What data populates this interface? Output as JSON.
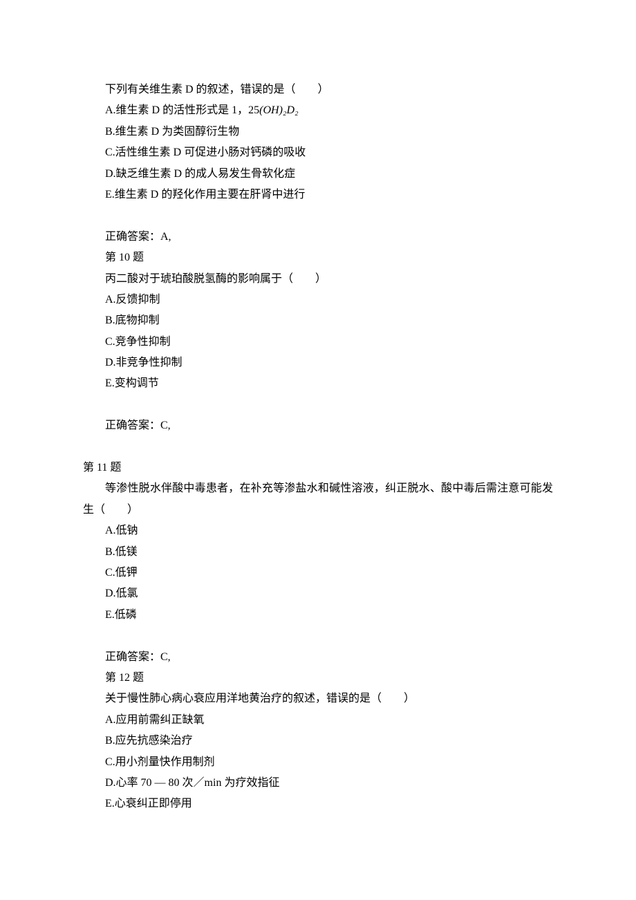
{
  "q9": {
    "stem_pre": "下列有关维生素 D 的叙述，错误的是（　　）",
    "optA_pre": "A.维生素 D 的活性形式是 1，25",
    "optA_formula": "(OH)₂D₂",
    "optB": "B.维生素 D 为类固醇衍生物",
    "optC": "C.活性维生素 D 可促进小肠对钙磷的吸收",
    "optD": "D.缺乏维生素 D 的成人易发生骨软化症",
    "optE": "E.维生素 D 的羟化作用主要在肝肾中进行",
    "answer": "正确答案：A,"
  },
  "q10": {
    "header": "第  10  题",
    "stem": "丙二酸对于琥珀酸脱氢酶的影响属于（　　）",
    "optA": "A.反馈抑制",
    "optB": "B.底物抑制",
    "optC": "C.竞争性抑制",
    "optD": "D.非竞争性抑制",
    "optE": "E.变构调节",
    "answer": "正确答案：C,"
  },
  "q11": {
    "header": "第  11  题",
    "stem": "等渗性脱水伴酸中毒患者，在补充等渗盐水和碱性溶液，纠正脱水、酸中毒后需注意可能发生（　　）",
    "optA": "A.低钠",
    "optB": "B.低镁",
    "optC": "C.低钾",
    "optD": "D.低氯",
    "optE": "E.低磷",
    "answer": "正确答案：C,"
  },
  "q12": {
    "header": "第  12  题",
    "stem": "关于慢性肺心病心衰应用洋地黄治疗的叙述，错误的是（　　）",
    "optA": "A.应用前需纠正缺氧",
    "optB": "B.应先抗感染治疗",
    "optC": "C.用小剂量快作用制剂",
    "optD": "D.心率 70 — 80 次／min 为疗效指征",
    "optE": "E.心衰纠正即停用"
  }
}
